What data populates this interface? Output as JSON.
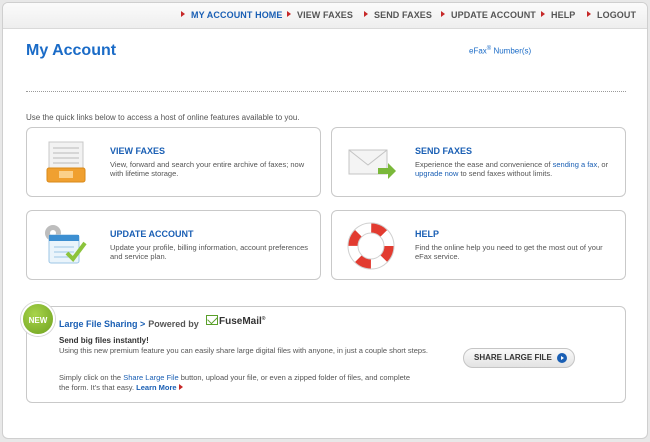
{
  "nav": {
    "items": [
      {
        "label": "MY ACCOUNT HOME",
        "active": true
      },
      {
        "label": "VIEW FAXES",
        "active": false
      },
      {
        "label": "SEND FAXES",
        "active": false
      },
      {
        "label": "UPDATE ACCOUNT",
        "active": false
      },
      {
        "label": "HELP",
        "active": false
      },
      {
        "label": "LOGOUT",
        "active": false
      }
    ]
  },
  "header": {
    "title": "My Account",
    "efax_label": "eFax",
    "efax_reg": "®",
    "efax_suffix": " Number(s)"
  },
  "intro": "Use the quick links below to access a host of online features available to you.",
  "cards": {
    "view": {
      "title": "VIEW FAXES",
      "desc": "View, forward and search your entire archive of faxes; now with lifetime storage."
    },
    "send": {
      "title": "SEND FAXES",
      "desc_pre": "Experience the ease and convenience of ",
      "link1": "sending a fax",
      "desc_mid": ", or ",
      "link2": "upgrade now",
      "desc_post": " to send faxes without limits."
    },
    "update": {
      "title": "UPDATE ACCOUNT",
      "desc": "Update your profile, billing information, account preferences and service plan."
    },
    "help": {
      "title": "HELP",
      "desc": "Find the online help you need to get the most out of your eFax service."
    }
  },
  "panel": {
    "badge": "NEW",
    "title": "Large File Sharing >",
    "powered": "Powered by",
    "brand": "FuseMail",
    "brand_tm": "®",
    "headline": "Send big files instantly!",
    "body1": "Using this new premium feature you can easily share large digital files with anyone, in just a couple short steps.",
    "body2_pre": "Simply click on the ",
    "body2_link": "Share Large File",
    "body2_post": " button, upload your file, or even a zipped folder of files, and complete the form. It's that easy. ",
    "learn_more": "Learn More",
    "button_label": "SHARE LARGE FILE"
  },
  "colors": {
    "accent": "#1a5fb4",
    "title_blue": "#1a6bc7",
    "arrow_red": "#c62828",
    "badge_green": "#7cb32a"
  }
}
